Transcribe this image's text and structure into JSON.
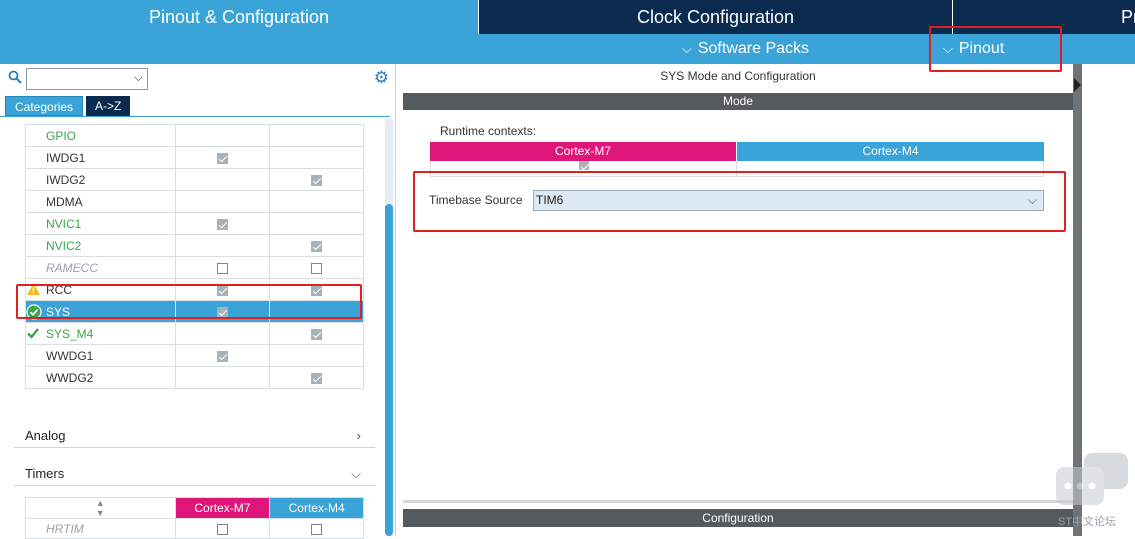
{
  "tabs": {
    "pinout_config": "Pinout & Configuration",
    "clock_config": "Clock Configuration",
    "project": "Pr"
  },
  "subbar": {
    "software_packs": "Software Packs",
    "pinout": "Pinout"
  },
  "left": {
    "search_value": "",
    "cat_tab_categories": "Categories",
    "cat_tab_az": "A->Z",
    "peripherals": [
      {
        "name": "GPIO",
        "m7": "",
        "m4": "",
        "style": "green"
      },
      {
        "name": "IWDG1",
        "m7": "checked",
        "m4": "",
        "style": ""
      },
      {
        "name": "IWDG2",
        "m7": "",
        "m4": "checked",
        "style": ""
      },
      {
        "name": "MDMA",
        "m7": "",
        "m4": "",
        "style": ""
      },
      {
        "name": "NVIC1",
        "m7": "checked",
        "m4": "",
        "style": "green"
      },
      {
        "name": "NVIC2",
        "m7": "",
        "m4": "checked",
        "style": "green"
      },
      {
        "name": "RAMECC",
        "m7": "unchecked",
        "m4": "unchecked",
        "style": "muted"
      },
      {
        "name": "RCC",
        "m7": "checked",
        "m4": "checked",
        "style": "",
        "icon": "warning"
      },
      {
        "name": "SYS",
        "m7": "checked",
        "m4": "",
        "style": "selected",
        "icon": "ok-circle"
      },
      {
        "name": "SYS_M4",
        "m7": "",
        "m4": "checked",
        "style": "green",
        "icon": "check"
      },
      {
        "name": "WWDG1",
        "m7": "checked",
        "m4": "",
        "style": ""
      },
      {
        "name": "WWDG2",
        "m7": "",
        "m4": "checked",
        "style": ""
      }
    ],
    "section_analog": "Analog",
    "section_timers": "Timers",
    "timers_head_m7": "Cortex-M7",
    "timers_head_m4": "Cortex-M4",
    "timers_first_row": "HRTIM"
  },
  "right": {
    "title": "SYS Mode and Configuration",
    "mode_header": "Mode",
    "runtime_label": "Runtime contexts:",
    "ctx_m7": "Cortex-M7",
    "ctx_m4": "Cortex-M4",
    "timebase_label": "Timebase Source",
    "timebase_value": "TIM6",
    "config_header": "Configuration"
  },
  "watermark": "ST中文论坛",
  "colors": {
    "accent_blue": "#3aa3d8",
    "navy": "#0a2a4f",
    "magenta": "#e0157a",
    "highlight_red": "#e02020"
  }
}
